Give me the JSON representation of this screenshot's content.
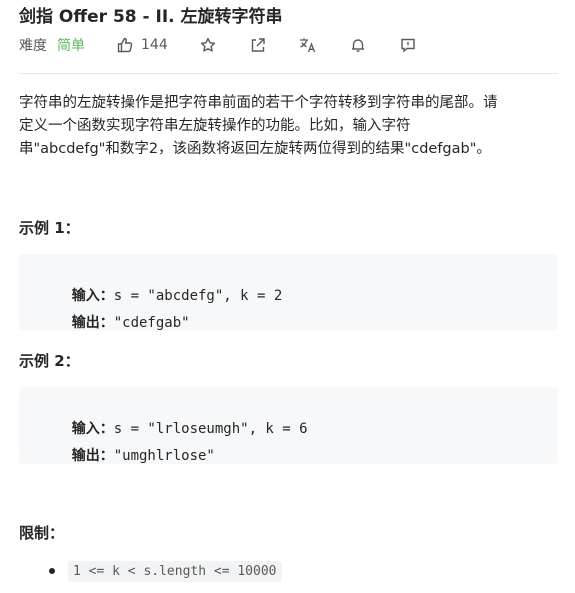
{
  "problem": {
    "title": "剑指 Offer 58 - II. 左旋转字符串",
    "difficulty_label": "难度",
    "difficulty_value": "简单",
    "likes": "144"
  },
  "toolbar_icons": [
    "thumbs-up-icon",
    "star-icon",
    "share-icon",
    "translate-icon",
    "bell-icon",
    "feedback-icon"
  ],
  "description": {
    "line1": "字符串的左旋转操作是把字符串前面的若干个字符转移到字符串的尾部。请",
    "line2": "定义一个函数实现字符串左旋转操作的功能。比如，输入字符",
    "line3": "串\"abcdefg\"和数字2，该函数将返回左旋转两位得到的结果\"cdefgab\"。"
  },
  "examples": [
    {
      "heading": "示例 1：",
      "input_label": "输入：",
      "input_value": "s = \"abcdefg\", k = 2",
      "output_label": "输出：",
      "output_value": "\"cdefgab\""
    },
    {
      "heading": "示例 2：",
      "input_label": "输入：",
      "input_value": "s = \"lrloseumgh\", k = 6",
      "output_label": "输出：",
      "output_value": "\"umghlrlose\""
    }
  ],
  "limits": {
    "heading": "限制：",
    "items": [
      "1 <= k < s.length <= 10000"
    ]
  },
  "colors": {
    "difficulty_easy": "#5cb85c",
    "text": "#262626",
    "code_bg": "#f7f8fa"
  }
}
